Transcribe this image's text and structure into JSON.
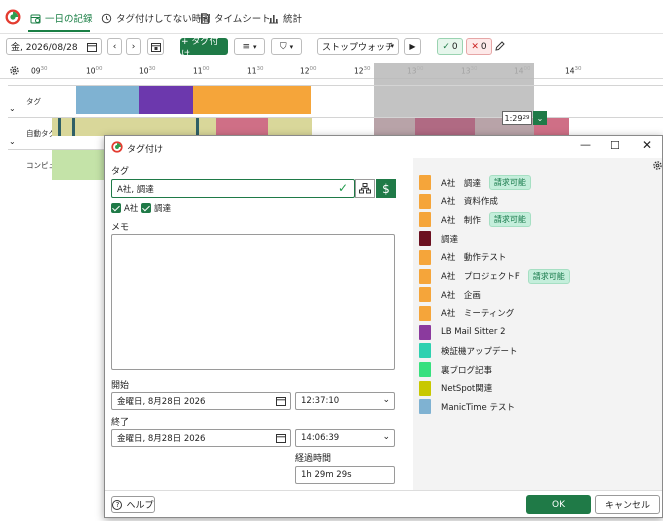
{
  "nav": {
    "tabs": [
      {
        "label": "一日の記録",
        "icon": "calendar-clock-icon"
      },
      {
        "label": "タグ付けしてない時間",
        "icon": "history-icon"
      },
      {
        "label": "タイムシート",
        "icon": "document-icon"
      },
      {
        "label": "統計",
        "icon": "bar-chart-icon"
      }
    ]
  },
  "toolbar": {
    "date_value": "金, 2026/08/28",
    "tag_button_label": "+ タグ付け",
    "stopwatch_label": "ストップウォッチ",
    "check_count": "0",
    "cross_count": "0"
  },
  "timeline": {
    "ticks": [
      {
        "hour": "09",
        "min": "30"
      },
      {
        "hour": "10",
        "min": "00"
      },
      {
        "hour": "10",
        "min": "30"
      },
      {
        "hour": "11",
        "min": "00"
      },
      {
        "hour": "11",
        "min": "30"
      },
      {
        "hour": "12",
        "min": "00"
      },
      {
        "hour": "12",
        "min": "30"
      },
      {
        "hour": "13",
        "min": "00"
      },
      {
        "hour": "13",
        "min": "30"
      },
      {
        "hour": "14",
        "min": "00"
      },
      {
        "hour": "14",
        "min": "30"
      }
    ],
    "rows": [
      "タグ",
      "自動タグ",
      "コンピューターの使用"
    ],
    "duration_badge": "1:29",
    "duration_badge_sup": "29"
  },
  "dialog": {
    "title": "タグ付け",
    "tag_label": "タグ",
    "tag_value": "A社, 調達",
    "chip_1": "A社",
    "chip_2": "調達",
    "memo_label": "メモ",
    "start_label": "開始",
    "start_date": "金曜日, 8月28日 2026",
    "start_time": "12:37:10",
    "end_label": "終了",
    "end_date": "金曜日, 8月28日 2026",
    "end_time": "14:06:39",
    "elapsed_label": "経過時間",
    "elapsed_value": "1h 29m 29s",
    "help_label": "ヘルプ",
    "ok_label": "OK",
    "cancel_label": "キャンセル"
  },
  "tags": [
    {
      "label": "A社　調達",
      "color": "#f5a53a",
      "badge": "請求可能"
    },
    {
      "label": "A社　資料作成",
      "color": "#f5a53a",
      "badge": ""
    },
    {
      "label": "A社　制作",
      "color": "#f5a53a",
      "badge": "請求可能"
    },
    {
      "label": "調達",
      "color": "#6b1020",
      "badge": ""
    },
    {
      "label": "A社　動作テスト",
      "color": "#f5a53a",
      "badge": ""
    },
    {
      "label": "A社　プロジェクトF",
      "color": "#f5a53a",
      "badge": "請求可能"
    },
    {
      "label": "A社　企画",
      "color": "#f5a53a",
      "badge": ""
    },
    {
      "label": "A社　ミーティング",
      "color": "#f5a53a",
      "badge": ""
    },
    {
      "label": "LB Mail Sitter 2",
      "color": "#8b3a9e",
      "badge": ""
    },
    {
      "label": "検証機アップデート",
      "color": "#2ed1b0",
      "badge": ""
    },
    {
      "label": "裏ブログ記事",
      "color": "#37e07e",
      "badge": ""
    },
    {
      "label": "NetSpot関連",
      "color": "#c8c800",
      "badge": ""
    },
    {
      "label": "ManicTime テスト",
      "color": "#7fb2d2",
      "badge": ""
    }
  ]
}
